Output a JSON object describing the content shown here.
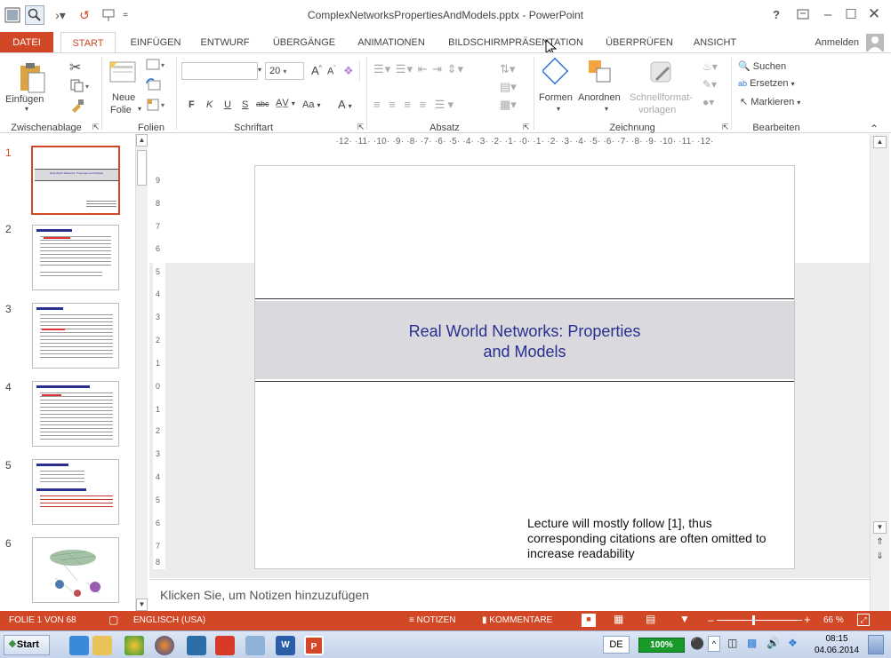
{
  "window": {
    "title": "ComplexNetworksPropertiesAndModels.pptx - PowerPoint",
    "help": "?",
    "signin": "Anmelden"
  },
  "tabs": [
    "DATEI",
    "START",
    "EINFÜGEN",
    "ENTWURF",
    "ÜBERGÄNGE",
    "ANIMATIONEN",
    "BILDSCHIRMPRÄSENTATION",
    "ÜBERPRÜFEN",
    "ANSICHT"
  ],
  "ribbon": {
    "groups": {
      "clipboard": "Zwischenablage",
      "slides": "Folien",
      "font": "Schriftart",
      "paragraph": "Absatz",
      "drawing": "Zeichnung",
      "editing": "Bearbeiten"
    },
    "paste": "Einfügen",
    "new_slide_1": "Neue",
    "new_slide_2": "Folie",
    "font_size": "20",
    "font_bold": "F",
    "font_italic": "K",
    "font_underline": "U",
    "font_shadow": "S",
    "font_strike": "abc",
    "font_case": "Aa",
    "font_grow": "A",
    "font_shrink": "A",
    "font_color": "A",
    "shapes": "Formen",
    "arrange": "Anordnen",
    "quickstyles_1": "Schnellformat-",
    "quickstyles_2": "vorlagen",
    "find": "Suchen",
    "replace": "Ersetzen",
    "select": "Markieren"
  },
  "ruler": {
    "horizontal": "·12· ·11· ·10· ·9· ·8· ·7· ·6· ·5· ·4· ·3· ·2· ·1· ·0· ·1· ·2· ·3· ·4· ·5· ·6· ·7· ·8· ·9· ·10· ·11· ·12·"
  },
  "slides": [
    {
      "num": "1",
      "title": "Real World Networks: Properties and Models"
    },
    {
      "num": "2",
      "title": "Modeling Real-world Networks"
    },
    {
      "num": "3",
      "title": "Social Networks"
    },
    {
      "num": "4",
      "title": "Information Networks / Knowledge-Nets"
    },
    {
      "num": "5",
      "title": "Technological Networks"
    },
    {
      "num": "6",
      "title": ""
    }
  ],
  "slide": {
    "title_line1": "Real World Networks: Properties",
    "title_line2": "and Models",
    "note_line1": "Lecture will mostly follow [1], thus",
    "note_line2": "corresponding citations are often omitted to",
    "note_line3": "increase readability"
  },
  "notes_placeholder": "Klicken Sie, um Notizen hinzuzufügen",
  "status": {
    "slide_of": "FOLIE 1 VON 68",
    "language": "ENGLISCH (USA)",
    "notes": "NOTIZEN",
    "comments": "KOMMENTARE",
    "zoom": "66 %"
  },
  "taskbar": {
    "start": "Start",
    "lang": "DE",
    "battery": "100%",
    "time": "08:15",
    "date": "04.06.2014"
  },
  "colors": {
    "accent": "#d24726",
    "slide_title": "#2a2f8f",
    "band": "#d9d9de"
  }
}
